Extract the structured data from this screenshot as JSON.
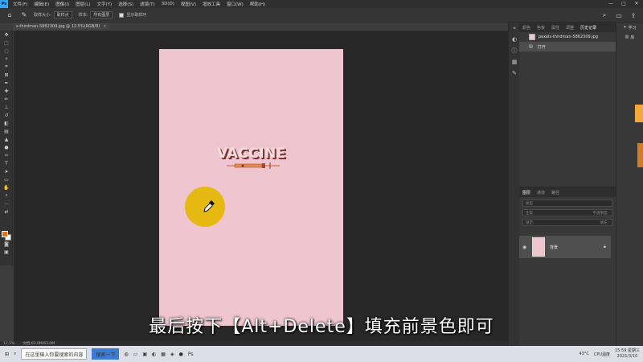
{
  "menubar": {
    "logo": "Ps",
    "items": [
      "文件(F)",
      "编辑(E)",
      "图像(I)",
      "图层(L)",
      "文字(Y)",
      "选择(S)",
      "滤镜(T)",
      "3D(D)",
      "视图(V)",
      "增效工具",
      "窗口(W)",
      "帮助(H)"
    ],
    "window_controls": [
      "—",
      "□",
      "✕"
    ]
  },
  "optionsbar": {
    "sample_size_label": "取样大小:",
    "sample_size_value": "取样点",
    "sample_label": "样本:",
    "sample_value": "所有图层",
    "show_ring_label": "显示取样环"
  },
  "document": {
    "tab_title": "s-thirdman-5862309.jpg @ 12.5%(RGB/8)",
    "close": "×",
    "canvas_color": "#efc5cf",
    "canvas_text": "VACCINE"
  },
  "statusbar": {
    "zoom": "12.5%",
    "doc_info": "文档:63.0M/63.0M"
  },
  "panels": {
    "top_tabs": [
      "颜色",
      "色板",
      "属性",
      "调整",
      "历史记录"
    ],
    "history_snapshot": "pexels-thirdman-5862309.jpg",
    "history_items": [
      "打开"
    ],
    "layers_tabs": [
      "图层",
      "通道",
      "路径"
    ],
    "layer_kind_placeholder": "类型",
    "blend_mode": "正常",
    "opacity_label": "不透明度:",
    "lock_label": "锁定:",
    "fill_label": "填充:",
    "layer_name": "背景"
  },
  "far_right": {
    "learn": "学习",
    "library": "库"
  },
  "subtitle": "最后按下【Alt+Delete】填充前景色即可",
  "taskbar": {
    "search_text": "在这里输入你要搜索的内容",
    "active_app": "搜索一下",
    "temperature": "43°C",
    "cpu_label": "CPU温度",
    "time": "15:59 星期三",
    "date": "2021/3/10"
  },
  "colors": {
    "foreground": "#e8711a",
    "background": "#ffffff",
    "highlight": "#e6b912"
  }
}
